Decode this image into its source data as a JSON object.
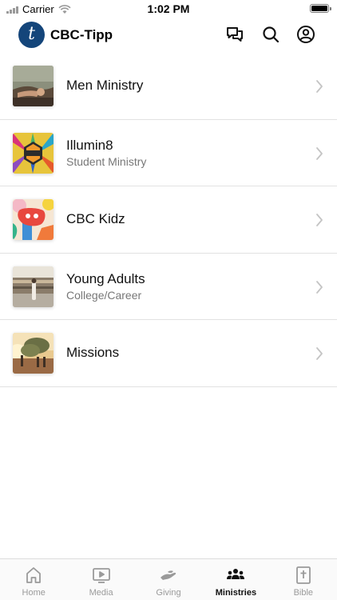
{
  "status_bar": {
    "carrier": "Carrier",
    "time": "1:02 PM"
  },
  "header": {
    "logo_letter": "t",
    "title": "CBC-Tipp",
    "icons": [
      "chat-icon",
      "search-icon",
      "profile-icon"
    ]
  },
  "ministries": [
    {
      "title": "Men Ministry",
      "subtitle": ""
    },
    {
      "title": "Illumin8",
      "subtitle": "Student Ministry"
    },
    {
      "title": "CBC Kidz",
      "subtitle": ""
    },
    {
      "title": "Young Adults",
      "subtitle": "College/Career"
    },
    {
      "title": "Missions",
      "subtitle": ""
    }
  ],
  "tabs": [
    {
      "label": "Home",
      "icon": "home-icon",
      "active": false
    },
    {
      "label": "Media",
      "icon": "media-icon",
      "active": false
    },
    {
      "label": "Giving",
      "icon": "giving-icon",
      "active": false
    },
    {
      "label": "Ministries",
      "icon": "ministries-icon",
      "active": true
    },
    {
      "label": "Bible",
      "icon": "bible-icon",
      "active": false
    }
  ],
  "colors": {
    "logo_bg": "#14457a",
    "active_tab": "#111111",
    "inactive_tab": "#9a9a9a"
  }
}
